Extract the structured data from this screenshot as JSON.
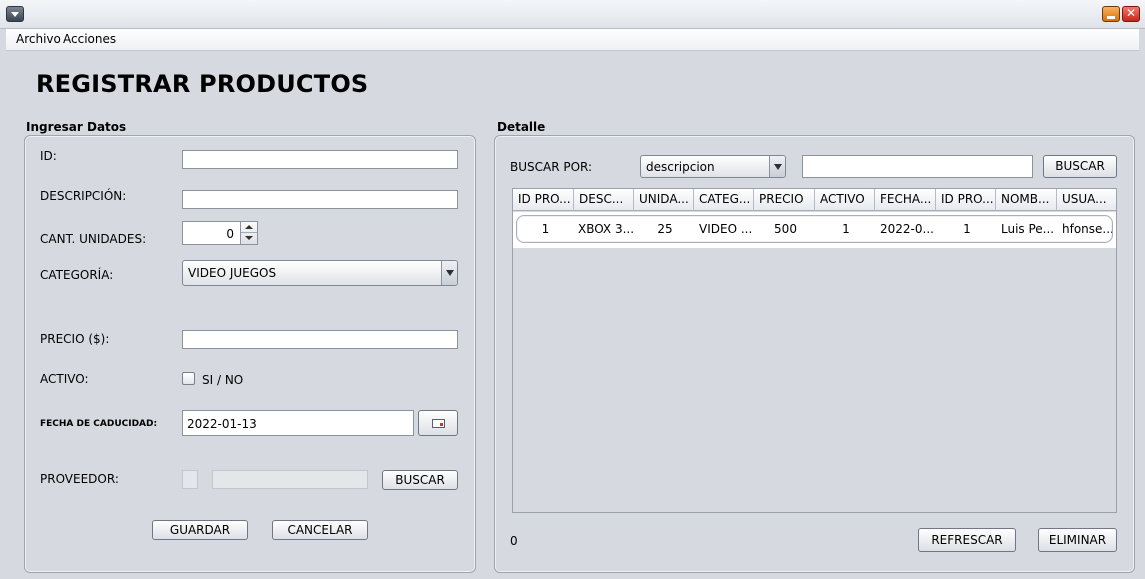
{
  "window": {
    "title": ""
  },
  "menu": {
    "items": [
      "Archivo",
      "Acciones"
    ]
  },
  "page": {
    "title": "REGISTRAR PRODUCTOS"
  },
  "form": {
    "section_label": "Ingresar Datos",
    "id_label": "ID:",
    "id_value": "",
    "descripcion_label": "DESCRIPCIÓN:",
    "descripcion_value": "",
    "cantidad_label": "CANT. UNIDADES:",
    "cantidad_value": "0",
    "categoria_label": "CATEGORÍA:",
    "categoria_value": "VIDEO JUEGOS",
    "precio_label": "PRECIO ($):",
    "precio_value": "",
    "activo_label": "ACTIVO:",
    "activo_checkbox_label": "SI / NO",
    "activo_checked": false,
    "fecha_label": "FECHA DE CADUCIDAD:",
    "fecha_value": "2022-01-13",
    "proveedor_label": "PROVEEDOR:",
    "proveedor_buscar_label": "BUSCAR",
    "guardar_label": "GUARDAR",
    "cancelar_label": "CANCELAR"
  },
  "detail": {
    "section_label": "Detalle",
    "buscar_por_label": "BUSCAR POR:",
    "buscar_por_value": "descripcion",
    "search_value": "",
    "buscar_label": "BUSCAR",
    "columns": [
      "ID PRO...",
      "DESC...",
      "UNIDA...",
      "CATEG...",
      "PRECIO",
      "ACTIVO",
      "FECHA...",
      "ID PRO...",
      "NOMB...",
      "USUA..."
    ],
    "rows": [
      [
        "1",
        "XBOX 3...",
        "25",
        "VIDEO ...",
        "500",
        "1",
        "2022-0...",
        "1",
        "Luis Pe...",
        "hfonse..."
      ]
    ],
    "count": "0",
    "refrescar_label": "REFRESCAR",
    "eliminar_label": "ELIMINAR"
  },
  "icons": {
    "system_menu": "chevron-down-icon",
    "minimize": "minimize-icon",
    "close": "close-icon",
    "calendar": "calendar-icon"
  }
}
